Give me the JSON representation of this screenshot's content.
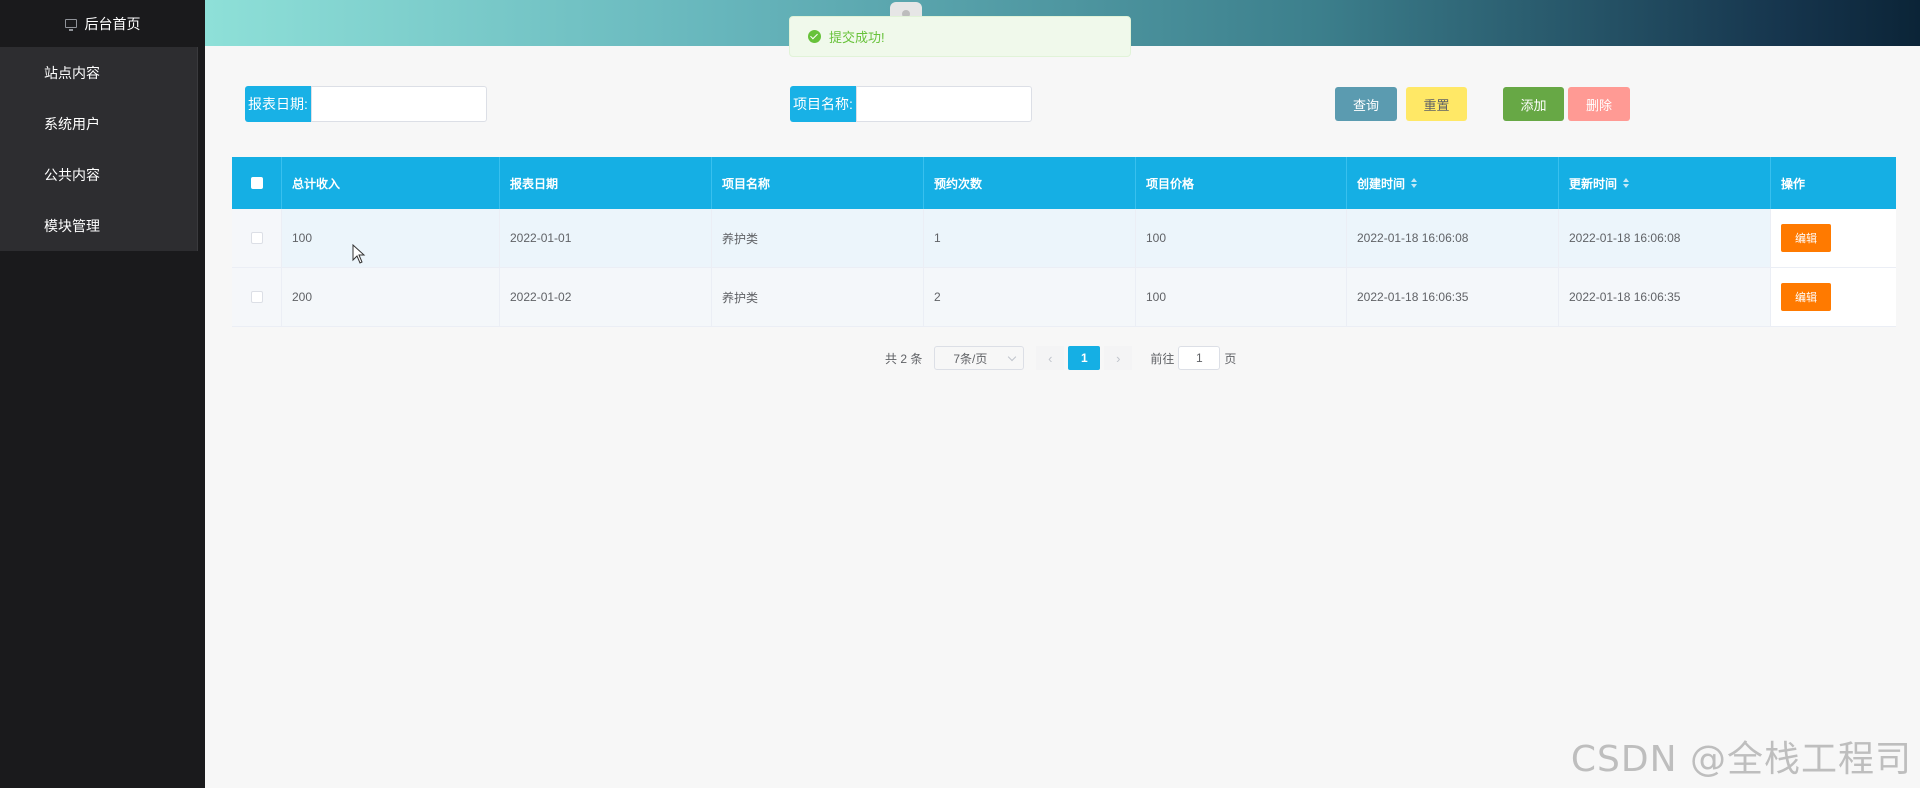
{
  "sidebar": {
    "home_label": "后台首页",
    "home_icon": "monitor-icon",
    "items": [
      {
        "label": "站点内容"
      },
      {
        "label": "系统用户"
      },
      {
        "label": "公共内容"
      },
      {
        "label": "模块管理"
      }
    ]
  },
  "toast": {
    "message": "提交成功!",
    "icon": "success-check-icon",
    "color": "#67c23a"
  },
  "search": {
    "date_label": "报表日期:",
    "date_value": "",
    "project_label": "项目名称:",
    "project_value": "",
    "query_label": "查询",
    "reset_label": "重置",
    "add_label": "添加",
    "delete_label": "删除"
  },
  "colors": {
    "accent": "#15afe4",
    "query_btn": "#5b9bb0",
    "reset_btn": "#ffe866",
    "add_btn": "#67a845",
    "delete_btn": "#ff9a94",
    "edit_btn": "#ff7a00"
  },
  "table": {
    "headers": [
      "总计收入",
      "报表日期",
      "项目名称",
      "预约次数",
      "项目价格",
      "创建时间",
      "更新时间",
      "操作"
    ],
    "rows": [
      {
        "income": "100",
        "date": "2022-01-01",
        "name": "养护类",
        "count": "1",
        "price": "100",
        "created": "2022-01-18 16:06:08",
        "updated": "2022-01-18 16:06:08",
        "action": "编辑"
      },
      {
        "income": "200",
        "date": "2022-01-02",
        "name": "养护类",
        "count": "2",
        "price": "100",
        "created": "2022-01-18 16:06:35",
        "updated": "2022-01-18 16:06:35",
        "action": "编辑"
      }
    ]
  },
  "pagination": {
    "total_text": "共 2 条",
    "page_size": "7条/页",
    "prev": "‹",
    "current_page": "1",
    "next": "›",
    "goto_label": "前往",
    "goto_value": "1",
    "goto_suffix": "页"
  },
  "watermark": "CSDN @全栈工程司"
}
